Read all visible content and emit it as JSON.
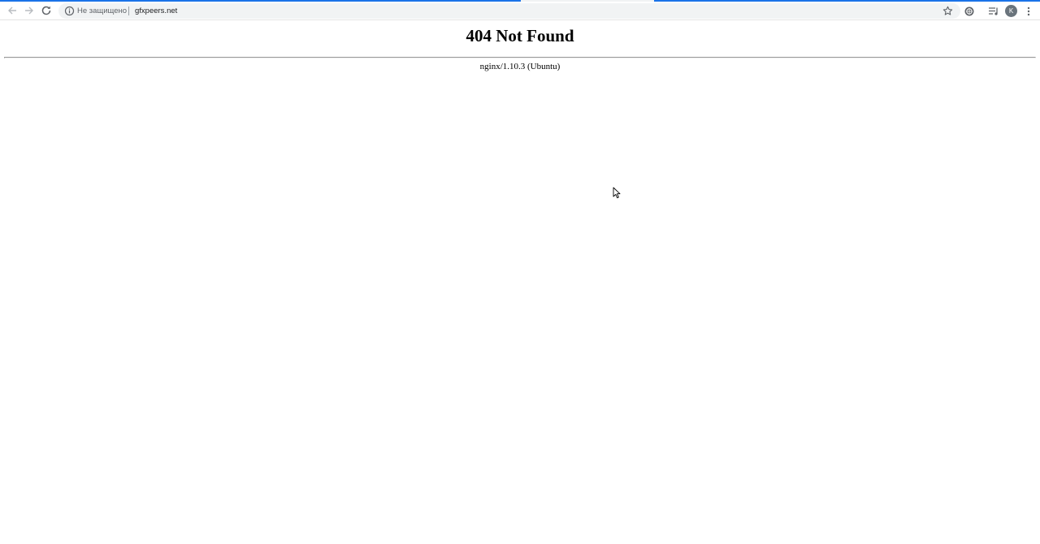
{
  "browser": {
    "security_label": "Не защищено",
    "url": "gfxpeers.net",
    "profile_initial": "K"
  },
  "icons": {
    "back": "back-arrow-icon",
    "forward": "forward-arrow-icon",
    "reload": "reload-icon",
    "info": "info-icon",
    "bookmark": "star-icon",
    "extension": "extension-icon",
    "media": "media-control-icon",
    "menu": "three-dots-menu-icon"
  },
  "page": {
    "title": "404 Not Found",
    "server_signature": "nginx/1.10.3 (Ubuntu)"
  },
  "colors": {
    "accent": "#1a73e8",
    "omnibox_bg": "#f1f3f4",
    "avatar_bg": "#6a747c"
  }
}
